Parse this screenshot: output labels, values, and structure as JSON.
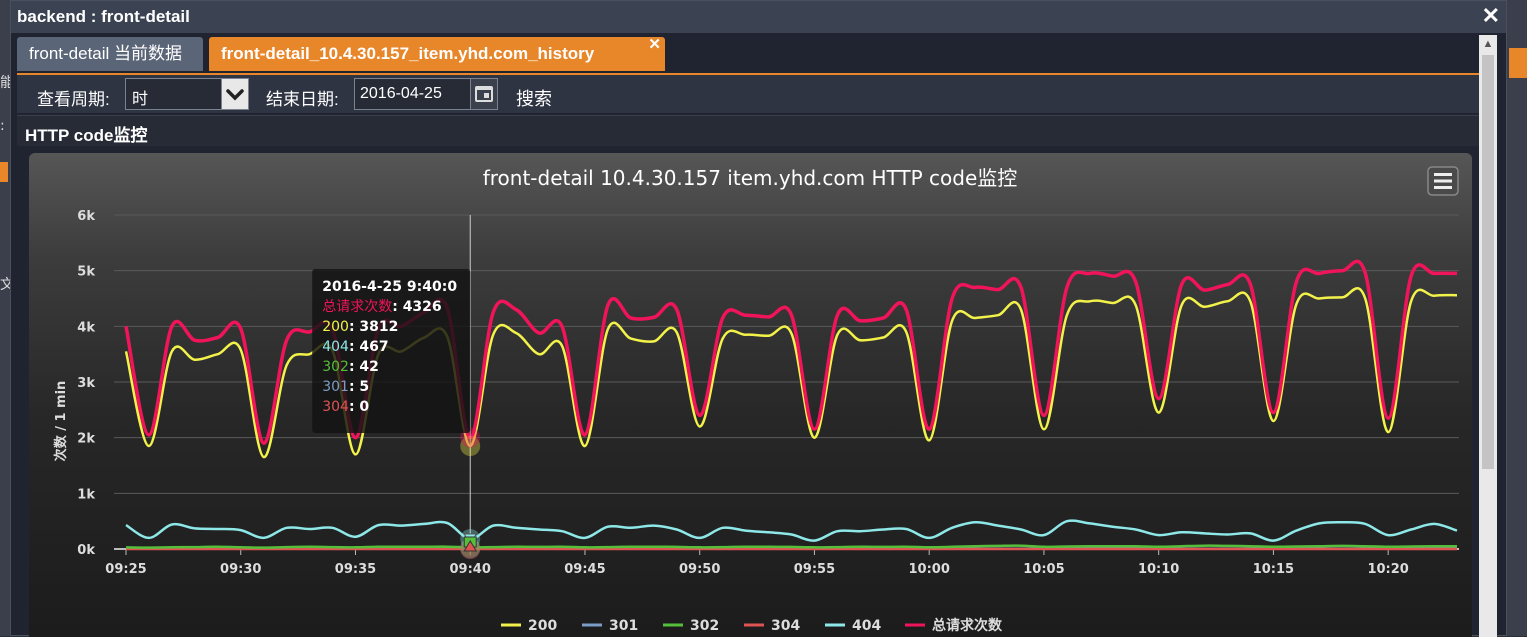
{
  "window": {
    "title": "backend : front-detail",
    "close": "✕"
  },
  "tabs": [
    {
      "label": "front-detail 当前数据",
      "active": false
    },
    {
      "label": "front-detail_10.4.30.157_item.yhd.com_history",
      "active": true,
      "close": "✕"
    }
  ],
  "toolbar": {
    "period_label": "查看周期:",
    "period_value": "时",
    "end_date_label": "结束日期:",
    "end_date_value": "2016-04-25",
    "search_label": "搜索"
  },
  "panel": {
    "title": "HTTP code监控"
  },
  "chart_data": {
    "type": "line",
    "title": "front-detail 10.4.30.157 item.yhd.com HTTP code监控",
    "ylabel": "次数 / 1 min",
    "xlabel": "",
    "y_ticks": [
      "0k",
      "1k",
      "2k",
      "3k",
      "4k",
      "5k",
      "6k"
    ],
    "x_ticks": [
      "09:25",
      "09:30",
      "09:35",
      "09:40",
      "09:45",
      "09:50",
      "09:55",
      "10:00",
      "10:05",
      "10:10",
      "10:15",
      "10:20"
    ],
    "ylim": [
      0,
      6000
    ],
    "grid": true,
    "legend_position": "bottom",
    "x_minutes": [
      0,
      1,
      2,
      3,
      4,
      5,
      6,
      7,
      8,
      9,
      10,
      11,
      12,
      13,
      14,
      15,
      16,
      17,
      18,
      19,
      20,
      21,
      22,
      23,
      24,
      25,
      26,
      27,
      28,
      29,
      30,
      31,
      32,
      33,
      34,
      35,
      36,
      37,
      38,
      39,
      40,
      41,
      42,
      43,
      44,
      45,
      46,
      47,
      48,
      49,
      50,
      51,
      52,
      53,
      54,
      55,
      56,
      57,
      58
    ],
    "series": [
      {
        "name": "200",
        "color": "#f2f24a",
        "values": [
          3550,
          1850,
          3550,
          3400,
          3500,
          3580,
          1650,
          3300,
          3500,
          3560,
          1700,
          3500,
          3550,
          3800,
          3812,
          1850,
          3850,
          3880,
          3500,
          3650,
          1850,
          3950,
          3780,
          3730,
          3890,
          2200,
          3780,
          3850,
          3830,
          3870,
          2000,
          3850,
          3750,
          3800,
          3900,
          1950,
          4100,
          4150,
          4200,
          4300,
          2150,
          4200,
          4450,
          4420,
          4380,
          2450,
          4380,
          4350,
          4450,
          4440,
          2300,
          4400,
          4500,
          4520,
          4500,
          2100,
          4450,
          4550,
          4560
        ]
      },
      {
        "name": "301",
        "color": "#7a9cc6",
        "values": [
          5,
          5,
          5,
          5,
          5,
          5,
          5,
          5,
          5,
          5,
          5,
          5,
          5,
          5,
          5,
          5,
          5,
          5,
          5,
          5,
          5,
          5,
          5,
          5,
          5,
          5,
          5,
          5,
          5,
          5,
          5,
          5,
          5,
          5,
          5,
          5,
          5,
          5,
          5,
          5,
          5,
          5,
          5,
          5,
          5,
          5,
          5,
          5,
          5,
          5,
          5,
          5,
          5,
          5,
          5,
          5,
          5,
          5,
          5
        ]
      },
      {
        "name": "302",
        "color": "#55bf3b",
        "values": [
          30,
          25,
          30,
          35,
          40,
          30,
          25,
          35,
          40,
          35,
          30,
          40,
          42,
          40,
          42,
          30,
          35,
          40,
          38,
          40,
          30,
          35,
          40,
          40,
          38,
          30,
          35,
          40,
          40,
          38,
          30,
          35,
          40,
          38,
          40,
          30,
          40,
          50,
          55,
          60,
          40,
          45,
          50,
          50,
          48,
          40,
          50,
          60,
          55,
          50,
          40,
          45,
          50,
          55,
          50,
          40,
          45,
          50,
          50
        ]
      },
      {
        "name": "304",
        "color": "#df5353",
        "values": [
          0,
          0,
          0,
          0,
          0,
          0,
          0,
          0,
          0,
          0,
          0,
          0,
          0,
          0,
          0,
          0,
          0,
          0,
          0,
          0,
          0,
          0,
          0,
          0,
          0,
          0,
          0,
          0,
          0,
          0,
          0,
          0,
          0,
          0,
          0,
          0,
          0,
          0,
          0,
          0,
          0,
          0,
          0,
          0,
          0,
          0,
          0,
          0,
          0,
          0,
          0,
          0,
          0,
          0,
          0,
          0,
          0,
          0,
          0
        ]
      },
      {
        "name": "404",
        "color": "#8ee8e8",
        "values": [
          430,
          200,
          440,
          370,
          360,
          340,
          200,
          380,
          360,
          380,
          220,
          430,
          420,
          450,
          467,
          180,
          420,
          380,
          350,
          320,
          200,
          400,
          380,
          420,
          350,
          200,
          380,
          330,
          300,
          260,
          150,
          320,
          320,
          350,
          360,
          200,
          380,
          480,
          420,
          350,
          250,
          500,
          460,
          400,
          350,
          250,
          300,
          280,
          260,
          280,
          150,
          330,
          460,
          480,
          450,
          250,
          350,
          450,
          330
        ]
      },
      {
        "name": "总请求次数",
        "color": "#f0145a",
        "values": [
          4000,
          2050,
          4000,
          3750,
          3800,
          3960,
          1900,
          3750,
          3900,
          3940,
          2000,
          3960,
          4000,
          4250,
          4326,
          2000,
          4250,
          4300,
          3880,
          4000,
          2050,
          4380,
          4150,
          4160,
          4300,
          2400,
          4150,
          4200,
          4170,
          4200,
          2150,
          4200,
          4100,
          4150,
          4300,
          2150,
          4500,
          4700,
          4660,
          4700,
          2400,
          4700,
          4950,
          4900,
          4800,
          2700,
          4750,
          4650,
          4750,
          4750,
          2450,
          4800,
          4950,
          5000,
          4960,
          2350,
          4900,
          4950,
          4950
        ]
      }
    ],
    "tooltip": {
      "title": "2016-4-25 9:40:0",
      "rows": [
        {
          "name": "总请求次数",
          "value": "4326"
        },
        {
          "name": "200",
          "value": "3812"
        },
        {
          "name": "404",
          "value": "467"
        },
        {
          "name": "302",
          "value": "42"
        },
        {
          "name": "301",
          "value": "5"
        },
        {
          "name": "304",
          "value": "0"
        }
      ],
      "x_minute": 15
    }
  },
  "icons": {
    "menu": "hamburger-menu-icon",
    "calendar": "calendar-icon",
    "dropdown": "chevron-down-icon"
  }
}
